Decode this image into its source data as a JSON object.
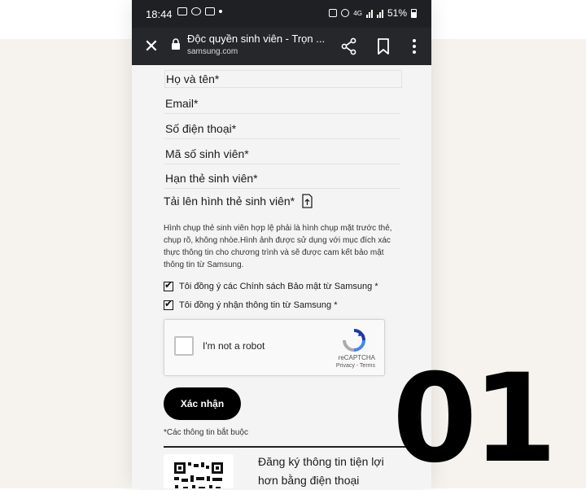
{
  "status_bar": {
    "time": "18:44",
    "network": "4G",
    "battery": "51%"
  },
  "browser": {
    "close_icon": "close-icon",
    "tab_title": "Độc quyền sinh viên - Trọn ...",
    "url": "samsung.com",
    "share_icon": "share-icon",
    "bookmark_icon": "bookmark-icon",
    "menu_icon": "more-vert-icon"
  },
  "form": {
    "fields": [
      {
        "label": "Họ và tên*"
      },
      {
        "label": "Email*"
      },
      {
        "label": "Số điện thoại*"
      },
      {
        "label": "Mã số sinh viên*"
      },
      {
        "label": "Hạn thẻ sinh viên*"
      }
    ],
    "upload_label": "Tải lên hình thẻ sinh viên*",
    "upload_icon": "file-upload-icon",
    "note": "Hình chụp thẻ sinh viên hợp lệ phải là hình chụp mặt trước thẻ, chụp rõ, không nhòe.Hình ảnh được sử dụng với mục đích xác thực thông tin cho chương trình và sẽ được cam kết bảo mật thông tin từ Samsung.",
    "consent_privacy": "Tôi đồng ý các Chính sách Bảo mật từ Samsung *",
    "consent_info": "Tôi đồng ý nhận thông tin từ Samsung *",
    "recaptcha": {
      "label": "I'm not a robot",
      "brand": "reCAPTCHA",
      "links": "Privacy - Terms"
    },
    "submit_label": "Xác nhận",
    "required_note": "*Các thông tin bắt buộc"
  },
  "promo": {
    "text": "Đăng ký thông tin tiện lợi hơn bằng điện thoại"
  },
  "overlay_label": "01"
}
